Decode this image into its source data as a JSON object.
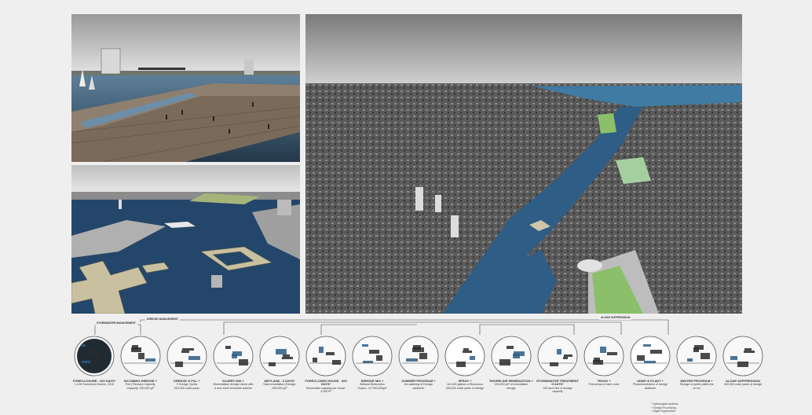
{
  "bands": {
    "stormwater": "STORMWATER MANAGEMENT",
    "dredge": "DREDGE MANAGEMENT",
    "algae": "ALGAE SUPPRESSION"
  },
  "steps": [
    {
      "title": "FORECLOSURE - 000 DAYS*",
      "line1": "1,128 Foreclosed Homes, 2010",
      "line2": ""
    },
    {
      "title": "INCOMING DREDGE +",
      "line1": "Port (Tributary Capacity:",
      "line2": "Capacity: 000,000 yd³"
    },
    {
      "title": "DREDGE & FILL +",
      "line1": "X Dredge Cycles",
      "line2": "000,000 cubic yards"
    },
    {
      "title": "SLURRY MIX +",
      "line1": "Biomediation dredge mixed with",
      "line2": "a new earth bentonite solution"
    },
    {
      "title": "WETLAND - 0 DAYS*",
      "line1": "Total remediation (Dredge:",
      "line2": "000,000 yd³"
    },
    {
      "title": "FORECLOSED HOUSE - 000 DAYS*",
      "line1": "Stormwater capacity per house:",
      "line2": "0,000 ft³"
    },
    {
      "title": "DREDGE MIX +",
      "line1": "Wetland Biofunction",
      "line2": "Output - m³ 000,000yd³"
    },
    {
      "title": "SUMMER PROGRAM +",
      "line1": "De-watering of Dredge",
      "line2": "sediment"
    },
    {
      "title": "SPRAY +",
      "line1": "114,000 gallons of Biochorus",
      "line2": "000,000 cubic yards of dredge"
    },
    {
      "title": "SHORELINE REMEDIATION +",
      "line1": "000,000 yd³ of remediation",
      "line2": "dredge"
    },
    {
      "title": "STORMWATER TREATMENT COATS*",
      "line1": "100 acre feet of dredge",
      "line2": "capacity"
    },
    {
      "title": "TRUCK +",
      "line1": "First areas of each route",
      "line2": ""
    },
    {
      "title": "UNZIP & PLANT +",
      "line1": "Phytoremediation of dredge",
      "line2": "sediment"
    },
    {
      "title": "WINTER PROGRAM +",
      "line1": "Storage of public platforms",
      "line2": "on ice"
    },
    {
      "title": "ALGAE SUPPRESSION",
      "line1": "000,000 cubic yards of dredge",
      "line2": ""
    }
  ],
  "legend": {
    "item1": "* Hydrological systems",
    "item2": "+ Dredge Processing",
    "item3": "+ Algae Suppression"
  },
  "colors": {
    "background": "#efefef",
    "water": "#2e5d86",
    "wetland": "#8bbf6a",
    "ink": "#2b2b2b"
  }
}
